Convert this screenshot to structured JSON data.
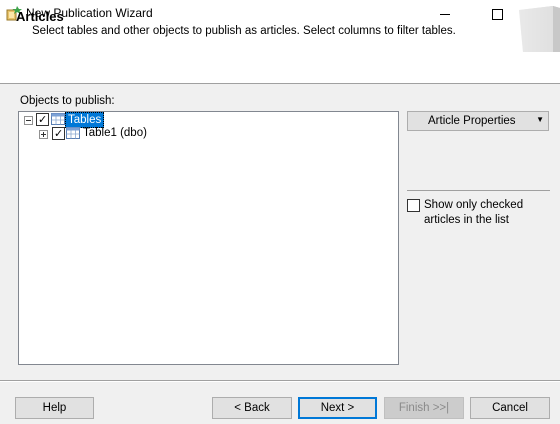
{
  "window": {
    "title": "New Publication Wizard",
    "controls": [
      "minimize-icon",
      "maximize-icon",
      "close-icon"
    ]
  },
  "header": {
    "title": "Articles",
    "subtitle": "Select tables and other objects to publish as articles. Select columns to filter tables."
  },
  "objects": {
    "label": "Objects to publish:",
    "tree": [
      {
        "label": "Tables",
        "checked": true,
        "expanded": true,
        "selected": true,
        "icon": "table-folder-icon"
      },
      {
        "label": "Table1 (dbo)",
        "checked": true,
        "expanded": false,
        "selected": false,
        "icon": "table-icon"
      }
    ]
  },
  "right_panel": {
    "article_properties_label": "Article Properties",
    "show_only_checked_label": "Show only checked articles in the list",
    "show_only_checked": false
  },
  "buttons": {
    "help": "Help",
    "back": "< Back",
    "next": "Next >",
    "finish": "Finish >>|",
    "cancel": "Cancel"
  },
  "colors": {
    "selection": "#0078d7",
    "background": "#f0f0f0",
    "button": "#e1e1e1"
  }
}
